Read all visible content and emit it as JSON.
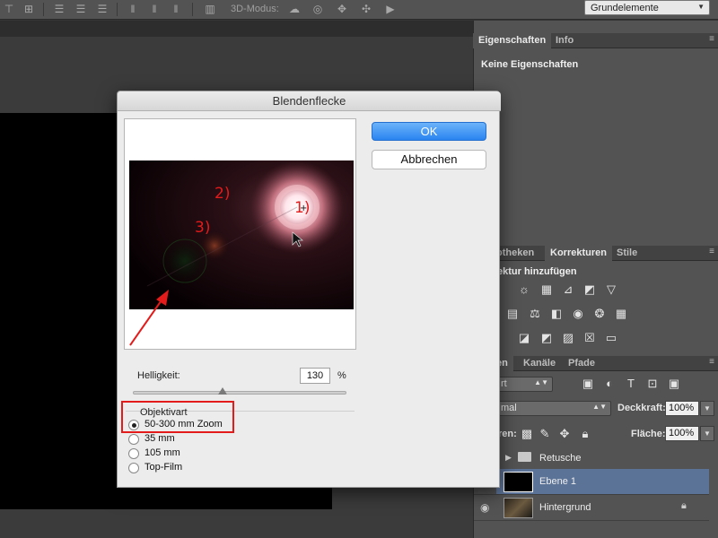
{
  "toolbar": {
    "mode3d_label": "3D-Modus:",
    "workspace_value": "Grundelemente",
    "icons": [
      "align-top-icon",
      "align-vcenter-icon",
      "align-bottom-icon",
      "align-left-icon",
      "align-hcenter-icon",
      "align-right-icon",
      "distribute-top-icon",
      "distribute-vcenter-icon",
      "distribute-bottom-icon",
      "distribute-left-icon",
      "distribute-hcenter-icon",
      "distribute-right-icon",
      "auto-align-icon",
      "orbit-3d-icon",
      "roll-3d-icon",
      "drag-3d-icon",
      "slide-3d-icon",
      "scale-3d-icon"
    ]
  },
  "panels": {
    "properties": {
      "tabs": [
        "Eigenschaften",
        "Info"
      ],
      "empty_text": "Keine Eigenschaften"
    },
    "adjustments": {
      "tabs": [
        "otheken",
        "Korrekturen",
        "Stile"
      ],
      "hint": "ektur hinzufügen",
      "icons": [
        "brightness-icon",
        "levels-icon",
        "curves-icon",
        "exposure-icon",
        "vibrance-icon",
        "hue-saturation-icon",
        "color-balance-icon",
        "black-white-icon",
        "photo-filter-icon",
        "channel-mixer-icon",
        "color-lookup-icon",
        "invert-icon",
        "posterize-icon",
        "threshold-icon",
        "gradient-map-icon",
        "selective-color-icon"
      ]
    },
    "layers": {
      "tabs": [
        "en",
        "Kanäle",
        "Pfade"
      ],
      "filter_kind": "rt",
      "blend_mode": "mal",
      "opacity_label": "Deckkraft:",
      "opacity_value": "100%",
      "lock_label": "ren:",
      "fill_label": "Fläche:",
      "fill_value": "100%",
      "items": [
        {
          "name": "Retusche",
          "type": "group"
        },
        {
          "name": "Ebene 1",
          "type": "layer"
        },
        {
          "name": "Hintergrund",
          "type": "background"
        }
      ]
    }
  },
  "dialog": {
    "title": "Blendenflecke",
    "ok_label": "OK",
    "cancel_label": "Abbrechen",
    "brightness_label": "Helligkeit:",
    "brightness_value": "130",
    "brightness_unit": "%",
    "brightness_slider": 0.42,
    "lens_group_title": "Objektivart",
    "lens_options": [
      "50-300 mm Zoom",
      "35 mm",
      "105 mm",
      "Top-Film"
    ],
    "lens_selected": "50-300 mm Zoom",
    "preview_annotations": [
      "1)",
      "2)",
      "3)"
    ],
    "annotation_color": "#e31b1b"
  }
}
